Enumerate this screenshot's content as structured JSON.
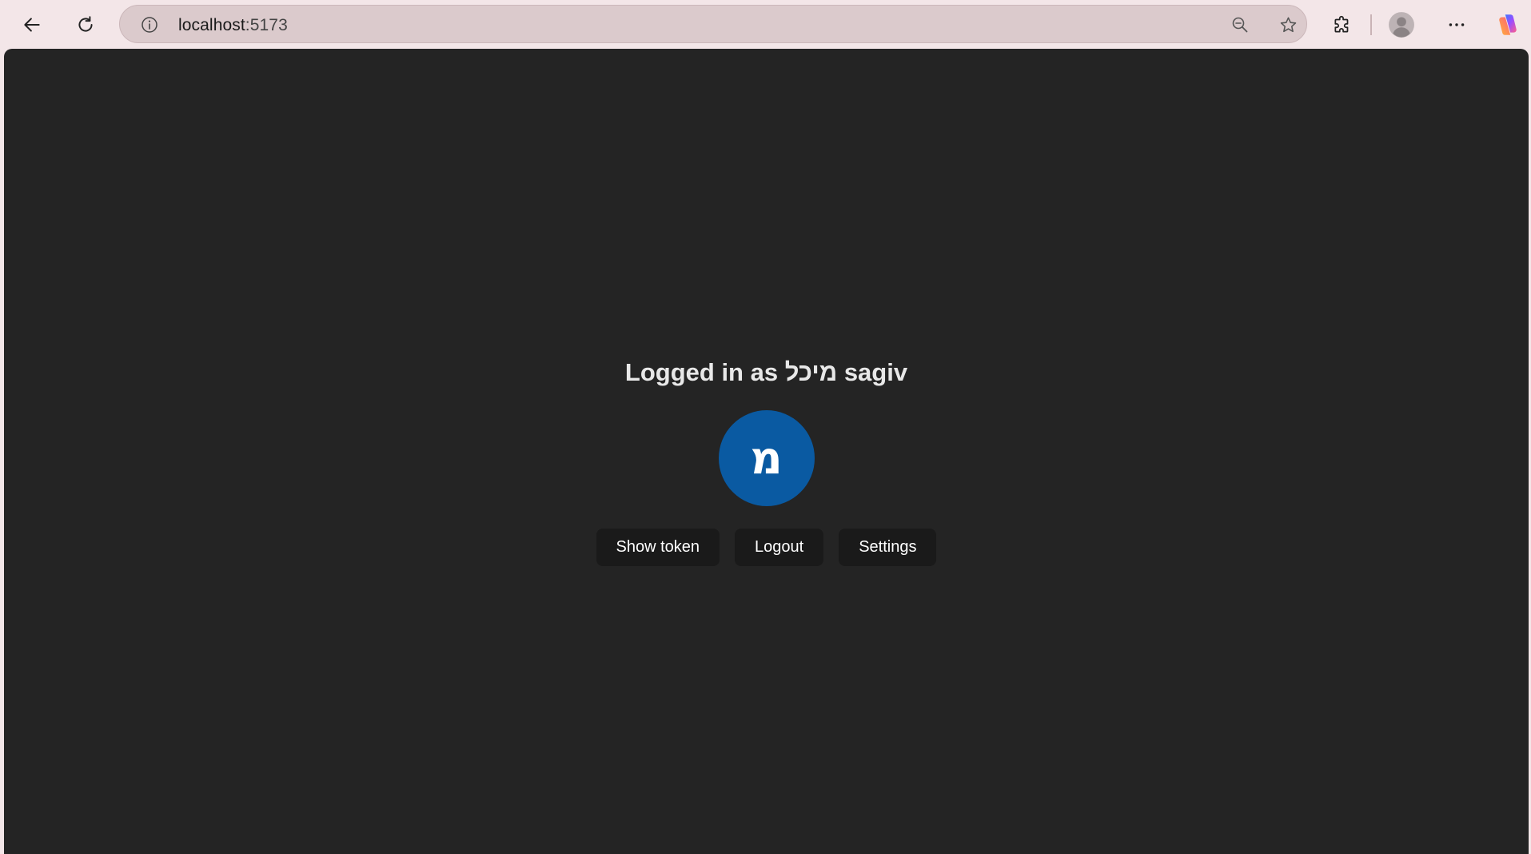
{
  "browser": {
    "url_host": "localhost",
    "url_port": ":5173",
    "icons": {
      "back": "back-arrow-icon",
      "reload": "reload-icon",
      "info": "info-icon",
      "zoom": "zoom-out-icon",
      "favorite": "star-icon",
      "extensions": "puzzle-icon",
      "profile": "profile-icon",
      "menu": "more-icon",
      "copilot": "copilot-icon"
    }
  },
  "page": {
    "title": "Logged in as מיכל sagiv",
    "avatar_initial": "מ",
    "avatar_color": "#0a5aa2",
    "buttons": {
      "show_token": "Show token",
      "logout": "Logout",
      "settings": "Settings"
    }
  }
}
